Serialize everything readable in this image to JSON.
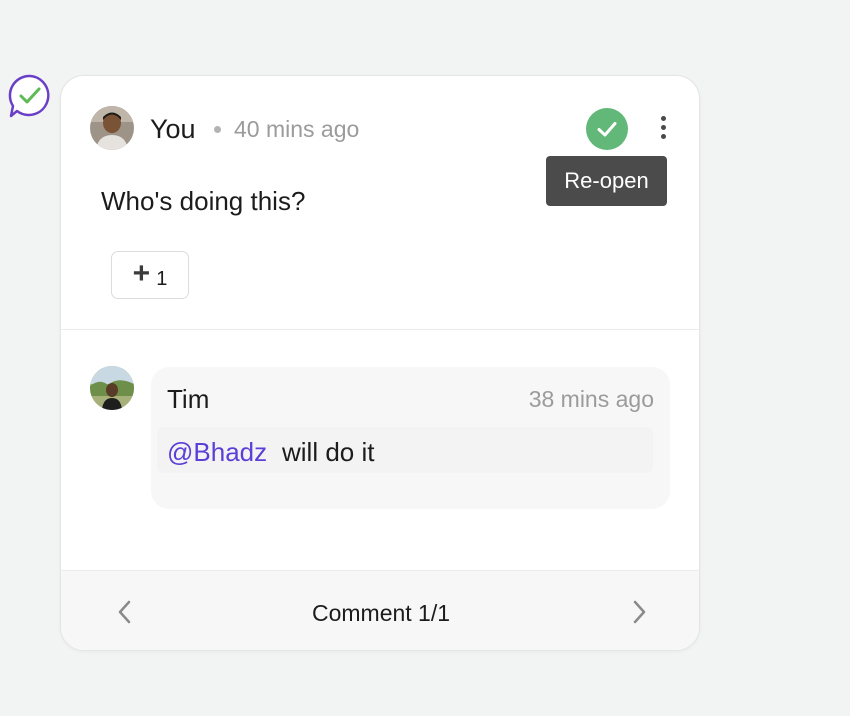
{
  "marker": {
    "icon": "check-bubble-icon",
    "color": "#6a3fc8"
  },
  "thread": {
    "author": "You",
    "time": "40 mins ago",
    "body": "Who's doing this?",
    "resolve_icon": "check-icon",
    "resolve_color": "#62b879",
    "more_icon": "more-vertical-icon",
    "tooltip": "Re-open",
    "reaction": {
      "icon": "plus-icon",
      "count": "1"
    }
  },
  "reply": {
    "author": "Tim",
    "time": "38 mins ago",
    "mention": "@Bhadz",
    "text": "will do it",
    "mention_color": "#5b3fd6"
  },
  "footer": {
    "label": "Comment 1/1",
    "prev_icon": "chevron-left-icon",
    "next_icon": "chevron-right-icon"
  }
}
